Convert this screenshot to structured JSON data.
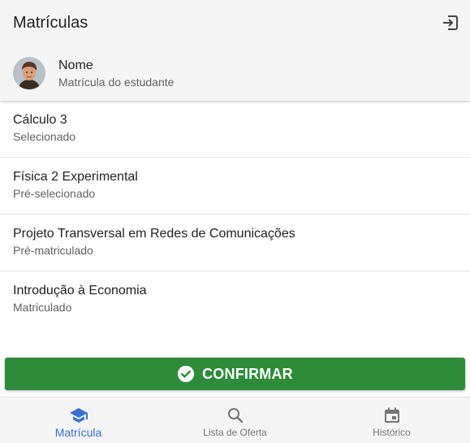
{
  "header": {
    "title": "Matrículas",
    "logout_icon": "logout-icon"
  },
  "profile": {
    "name": "Nome",
    "subtitle": "Matrícula do estudante",
    "avatar_icon": "avatar"
  },
  "courses": [
    {
      "title": "Cálculo 3",
      "status": "Selecionado"
    },
    {
      "title": "Física 2 Experimental",
      "status": "Pré-selecionado"
    },
    {
      "title": "Projeto Transversal em Redes de Comunicações",
      "status": "Pré-matriculado"
    },
    {
      "title": "Introdução à Economia",
      "status": "Matriculado"
    }
  ],
  "confirm": {
    "label": "CONFIRMAR",
    "icon": "check-circle-icon",
    "color": "#2e8b3a"
  },
  "bottom_nav": {
    "items": [
      {
        "label": "Matrícula",
        "icon": "graduation-cap-icon",
        "active": true
      },
      {
        "label": "Lista de Oferta",
        "icon": "search-icon",
        "active": false
      },
      {
        "label": "Histórico",
        "icon": "calendar-icon",
        "active": false
      }
    ],
    "active_color": "#3b6fd0"
  }
}
